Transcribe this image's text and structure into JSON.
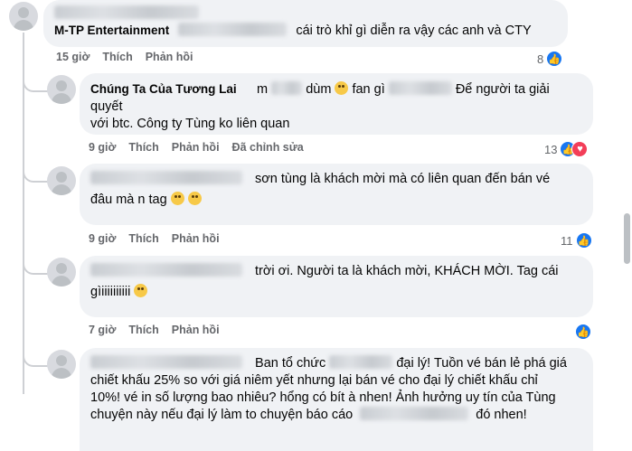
{
  "comments": [
    {
      "author": "M-TP Entertainment",
      "text_after": "cái trò khỉ gì diễn ra vậy các anh và CTY",
      "time": "15 giờ",
      "like": "Thích",
      "reply": "Phản hồi",
      "reaction_count": "8"
    },
    {
      "author": "Chúng Ta Của Tương Lai",
      "text_part1": "m",
      "text_part2": "dùm",
      "text_part3": "fan gì",
      "text_part4": "Để người ta giải quyết",
      "text_line2": "với btc. Công ty Tùng ko liên quan",
      "time": "9 giờ",
      "like": "Thích",
      "reply": "Phản hồi",
      "edited": "Đã chỉnh sửa",
      "reaction_count": "13"
    },
    {
      "text_line1": "sơn tùng là khách mời mà có liên quan đến bán vé",
      "text_line2": "đâu mà n tag",
      "time": "9 giờ",
      "like": "Thích",
      "reply": "Phản hồi",
      "reaction_count": "11"
    },
    {
      "text_line1": "trời ơi. Người ta là khách mời, KHÁCH MỜI. Tag cái",
      "text_line2": "gìiiiiiiiiii",
      "time": "7 giờ",
      "like": "Thích",
      "reply": "Phản hồi",
      "reaction_count": ""
    },
    {
      "text_a": "Ban tổ chức",
      "text_b": "đại lý! Tuồn vé bán lẻ phá giá",
      "text_line2": "chiết khấu 25% so với giá niêm yết nhưng lại bán vé cho đại lý chiết khấu chỉ",
      "text_line3": "10%! vé in số lượng bao nhiêu? hổng có bít à nhen! Ảnh hưởng uy tín của Tùng",
      "text_line4a": "chuyện này nếu đại lý làm to chuyện báo cáo",
      "text_line4b": "đó nhen!"
    }
  ],
  "colors": {
    "like_blue": "#1877f2",
    "love_red": "#f33e58",
    "bubble": "#f0f2f5",
    "meta_gray": "#65676b"
  }
}
